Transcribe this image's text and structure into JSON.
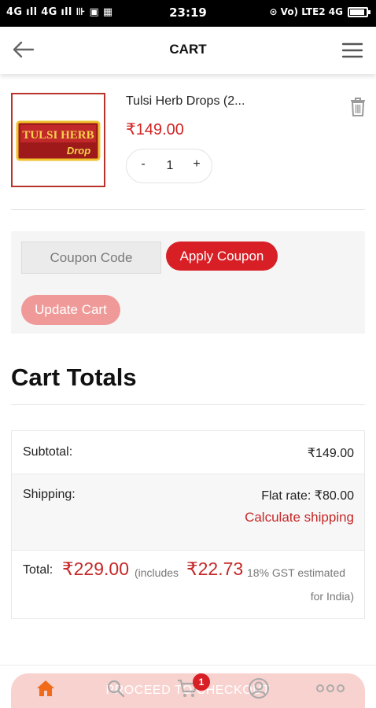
{
  "status_bar": {
    "left_text": "4G ıll 4G ıll ⊪ ▣ ▦",
    "time": "23:19",
    "right_text": "⊙ Vo) LTE2 4G"
  },
  "header": {
    "title": "CART"
  },
  "cart_item": {
    "name": "Tulsi Herb Drops (2...",
    "price": "₹149.00",
    "quantity": "1",
    "minus_label": "-",
    "plus_label": "+",
    "thumbnail_text_line1": "TULSI HERB",
    "thumbnail_text_line2": "Drop"
  },
  "coupon": {
    "placeholder": "Coupon Code",
    "apply_label": "Apply Coupon",
    "update_label": "Update Cart"
  },
  "totals": {
    "heading": "Cart Totals",
    "subtotal_label": "Subtotal:",
    "subtotal_value": "₹149.00",
    "shipping_label": "Shipping:",
    "shipping_value": "Flat rate: ₹80.00",
    "calculate_shipping": "Calculate shipping",
    "total_label": "Total:",
    "total_value": "₹229.00",
    "includes_text": "(includes",
    "tax_value": "₹22.73",
    "gst_text": "18% GST estimated",
    "india_text": "for India)"
  },
  "checkout": {
    "label": "PROCEED TO CHECKOUT"
  },
  "bottom_nav": {
    "cart_badge": "1",
    "items": [
      "home-icon",
      "search-icon",
      "cart-icon",
      "account-icon",
      "more-icon"
    ]
  },
  "colors": {
    "accent": "#d81f26",
    "price": "#c62828",
    "status_bar": "#000000"
  }
}
